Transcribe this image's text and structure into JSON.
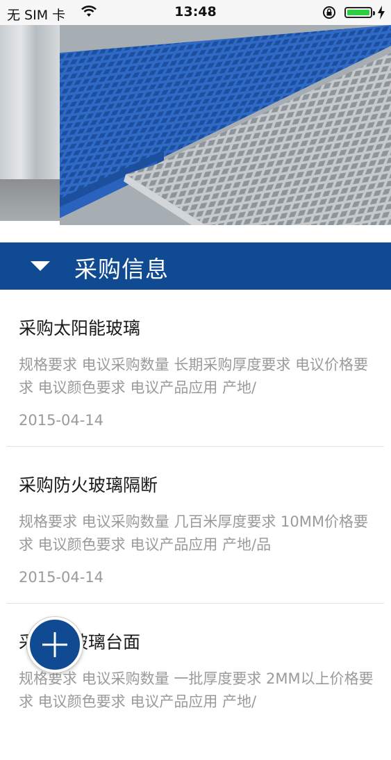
{
  "status_bar": {
    "carrier": "无 SIM 卡",
    "time": "13:48"
  },
  "banner": {
    "page_count": 3,
    "active_page_index": 1
  },
  "section": {
    "title": "采购信息"
  },
  "purchases": [
    {
      "title": "采购太阳能玻璃",
      "description": "规格要求 电议采购数量 长期采购厚度要求 电议价格要求 电议颜色要求 电议产品应用 产地/",
      "date": "2015-04-14"
    },
    {
      "title": "采购防火玻璃隔断",
      "description": "规格要求 电议采购数量 几百米厚度要求 10MM价格要求 电议颜色要求 电议产品应用 产地/品",
      "date": "2015-04-14"
    },
    {
      "title": "采购晶玻璃台面",
      "description": "规格要求 电议采购数量 一批厚度要求 2MM以上价格要求 电议颜色要求 电议产品应用 产地/",
      "date": ""
    }
  ],
  "colors": {
    "brand_blue": "#0f4a93",
    "dot_active": "#1a73c7",
    "grating_blue": "#2f6bc6",
    "grating_gray": "#b9bec2"
  },
  "icons": {
    "wifi": "wifi-icon",
    "lock": "rotation-lock-icon",
    "battery": "battery-icon",
    "charging": "charging-bolt-icon",
    "section_toggle": "triangle-down-icon",
    "add": "plus-icon"
  }
}
